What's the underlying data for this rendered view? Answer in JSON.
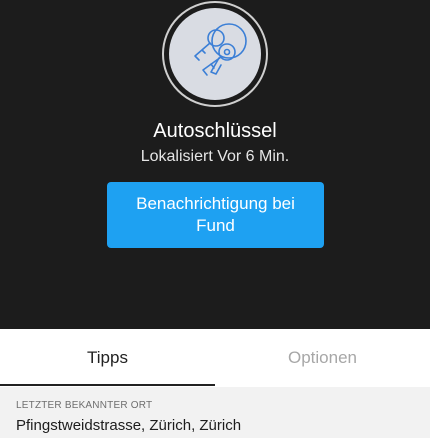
{
  "item": {
    "name": "Autoschlüssel",
    "status": "Lokalisiert Vor 6 Min.",
    "icon": "car-keys-icon"
  },
  "actions": {
    "notify_label": "Benachrichtigung bei Fund",
    "accent_color": "#1ea1f2"
  },
  "tabs": [
    {
      "label": "Tipps",
      "active": true
    },
    {
      "label": "Optionen",
      "active": false
    }
  ],
  "location": {
    "heading": "LETZTER BEKANNTER ORT",
    "address": "Pfingstweidstrasse, Zürich, Zürich"
  }
}
